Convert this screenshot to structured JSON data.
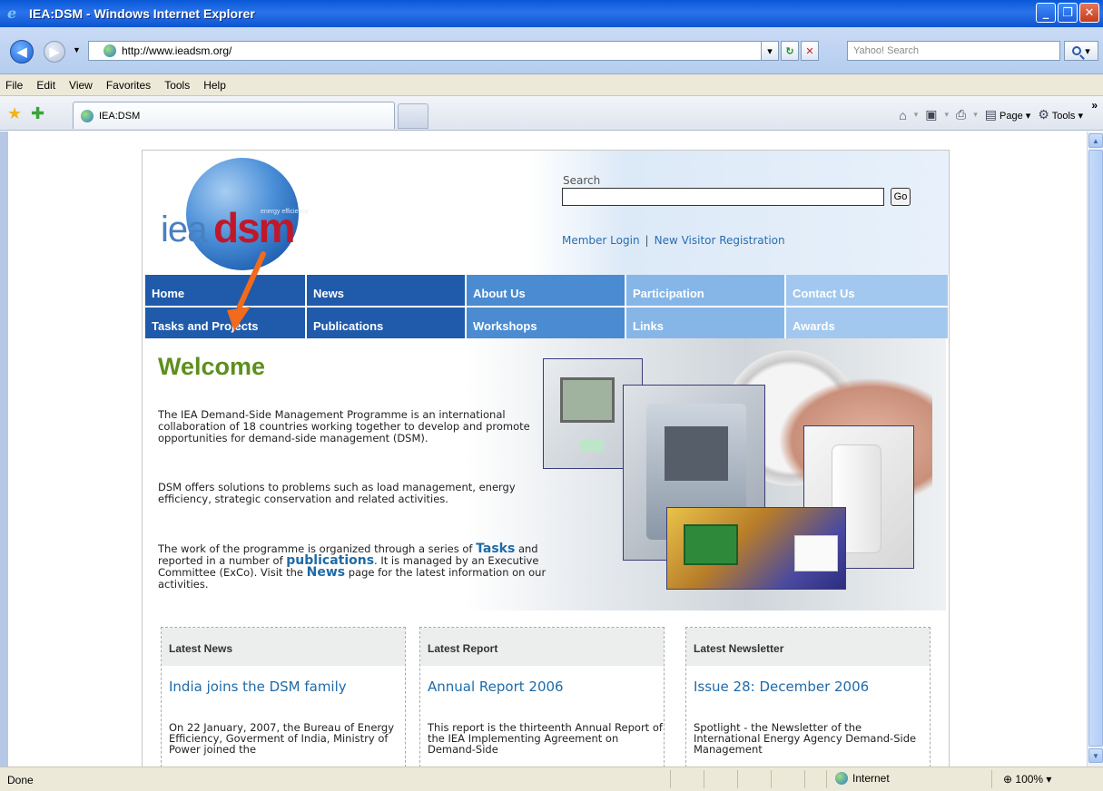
{
  "window": {
    "title": "IEA:DSM - Windows Internet Explorer"
  },
  "address": {
    "url": "http://www.ieadsm.org/",
    "search_placeholder": "Yahoo! Search"
  },
  "menu": [
    "File",
    "Edit",
    "View",
    "Favorites",
    "Tools",
    "Help"
  ],
  "tab": {
    "label": "IEA:DSM"
  },
  "commandbar": {
    "page": "Page",
    "tools": "Tools"
  },
  "site": {
    "logo": {
      "iea": "iea",
      "dsm": "dsm",
      "tagline": "energy efficiency"
    },
    "search_label": "Search",
    "go_label": "Go",
    "member_login": "Member Login",
    "separator": "|",
    "new_visitor": "New Visitor Registration",
    "nav_row1": [
      "Home",
      "News",
      "About Us",
      "Participation",
      "Contact Us"
    ],
    "nav_row2": [
      "Tasks and Projects",
      "Publications",
      "Workshops",
      "Links",
      "Awards"
    ],
    "welcome_title": "Welcome",
    "para1": "The IEA Demand-Side Management Programme is an international collaboration of 18 countries working together to develop and promote opportunities for demand-side management (DSM).",
    "para2": "DSM offers solutions to problems such as load management, energy efficiency, strategic conservation and related activities.",
    "para3": {
      "t1": "The work of the programme is organized through a series of ",
      "tasks": "Tasks",
      "t2": " and reported in a number of ",
      "publications": "publications",
      "t3": ". It is managed by an Executive Committee (ExCo). Visit the ",
      "news": "News",
      "t4": " page for the latest information on our activities."
    },
    "columns": [
      {
        "head": "Latest News",
        "headline": "India joins the DSM family",
        "body": "On 22 January, 2007, the Bureau of Energy Efficiency, Goverment of India, Ministry of Power joined the"
      },
      {
        "head": "Latest Report",
        "headline": "Annual Report 2006",
        "body": "This report is the thirteenth Annual Report of the IEA Implementing Agreement on Demand-Side"
      },
      {
        "head": "Latest Newsletter",
        "headline": "Issue 28: December 2006",
        "body": "Spotlight - the Newsletter of the International Energy Agency Demand-Side Management"
      }
    ]
  },
  "status": {
    "text": "Done",
    "zone": "Internet",
    "zoom": "100%"
  },
  "colors": {
    "nav_dark": "#1f5aab",
    "welcome_green": "#5e8f1d",
    "link_blue": "#1f6aa8",
    "arrow_orange": "#f26a1b"
  }
}
